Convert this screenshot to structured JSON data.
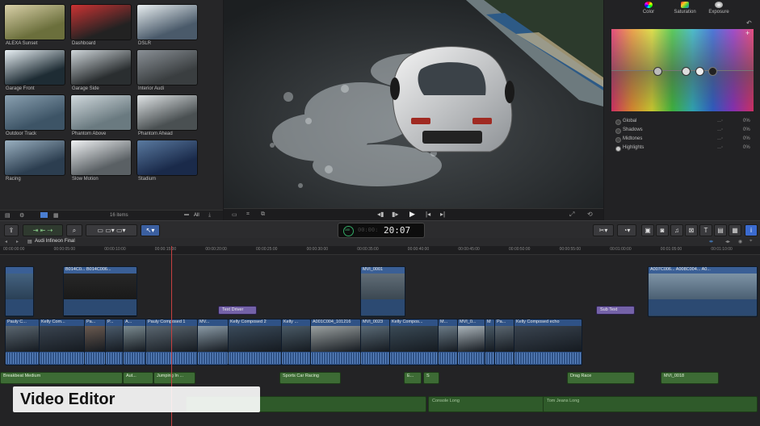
{
  "browser": {
    "clips": [
      {
        "label": "ALEXA Sunset"
      },
      {
        "label": "Dashboard"
      },
      {
        "label": "DSLR"
      },
      {
        "label": "Garage Front"
      },
      {
        "label": "Garage Side"
      },
      {
        "label": "Interior Audi"
      },
      {
        "label": "Outdoor Track"
      },
      {
        "label": "Phantom Above"
      },
      {
        "label": "Phantom Ahead"
      },
      {
        "label": "Racing"
      },
      {
        "label": "Slow Motion"
      },
      {
        "label": "Stadium"
      }
    ],
    "item_count": "16 items",
    "filter": "All"
  },
  "inspector": {
    "tabs": [
      "Color",
      "Saturation",
      "Exposure"
    ],
    "ranges": [
      {
        "label": "Global",
        "value": "0%"
      },
      {
        "label": "Shadows",
        "value": "0%"
      },
      {
        "label": "Midtones",
        "value": "0%"
      },
      {
        "label": "Highlights",
        "value": "0%"
      }
    ]
  },
  "toolbar": {
    "timecode": "20:07",
    "timecode_small": "100"
  },
  "timeline": {
    "project_name": "Audi Infineon Final",
    "ruler": [
      "00:00:00:00",
      "00:00:05:00",
      "00:00:10:00",
      "00:00:15:00",
      "00:00:20:00",
      "00:00:25:00",
      "00:00:30:00",
      "00:00:35:00",
      "00:00:40:00",
      "00:00:45:00",
      "00:00:50:00",
      "00:00:55:00",
      "00:01:00:00",
      "00:01:05:00",
      "00:01:10:00"
    ],
    "connected_clips": [
      "B014C0...",
      "B014C006...",
      "MVI_0001",
      "A007C006...",
      "A008C004...",
      "A0..."
    ],
    "titles": [
      "Text Driver",
      "Sub Text"
    ],
    "primary_clips": [
      "Pauly C...",
      "Kelly Com...",
      "Pa...",
      "P...",
      "A...",
      "Pauly Composed 1",
      "MV...",
      "Kelly Composed 2",
      "Kelly ...",
      "A001C004_101216",
      "MVI_0023",
      "Kelly Compos...",
      "M...",
      "MVI_0...",
      "M",
      "Pa...",
      "Kelly Composed echo"
    ],
    "audio_clips": [
      "Breakbeat Medium",
      "Aut...",
      "Jumping In ...",
      "Sports Car Racing",
      "E...",
      "S",
      "Drag Race",
      "MVI_0018"
    ],
    "music_clips": [
      "Console Long",
      "Tom Jeans Long"
    ]
  },
  "overlay": {
    "label": "Video Editor"
  }
}
